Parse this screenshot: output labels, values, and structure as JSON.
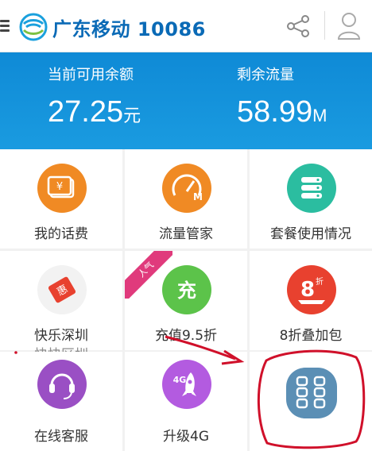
{
  "header": {
    "title": "广东移动 10086",
    "menu_icon": "hamburger-icon",
    "share_icon": "share-icon",
    "user_icon": "user-icon",
    "brand_color": "#0a6ab6"
  },
  "balance": {
    "balance_label": "当前可用余额",
    "balance_value": "27.25",
    "balance_unit": "元",
    "data_label": "剩余流量",
    "data_value": "58.99",
    "data_unit": "M",
    "bg_color": "#1191d9"
  },
  "grid": {
    "items": [
      {
        "label": "我的话费",
        "icon": "wallet-icon",
        "color": "#f08a24"
      },
      {
        "label": "流量管家",
        "icon": "speedometer-icon",
        "color": "#f08a24"
      },
      {
        "label": "套餐使用情况",
        "icon": "database-icon",
        "color": "#2bbda0"
      },
      {
        "label": "快乐深圳",
        "icon": "coupon-icon",
        "color": "#f0f0f0",
        "overlap_text": "快快区圳"
      },
      {
        "label": "充值9.5折",
        "icon": "recharge-icon",
        "color": "#5cc34a",
        "ribbon": "人气"
      },
      {
        "label": "8折叠加包",
        "icon": "discount-8-icon",
        "color": "#e8412f"
      },
      {
        "label": "在线客服",
        "icon": "headset-icon",
        "color": "#9a4fc4"
      },
      {
        "label": "升级4G",
        "icon": "rocket-4g-icon",
        "color": "#b35be0"
      },
      {
        "label": "",
        "icon": "more-apps-icon",
        "color": "#5b8fb5"
      }
    ]
  },
  "annotations": {
    "arrow_color": "#d0102a",
    "circle_color": "#d0102a"
  }
}
